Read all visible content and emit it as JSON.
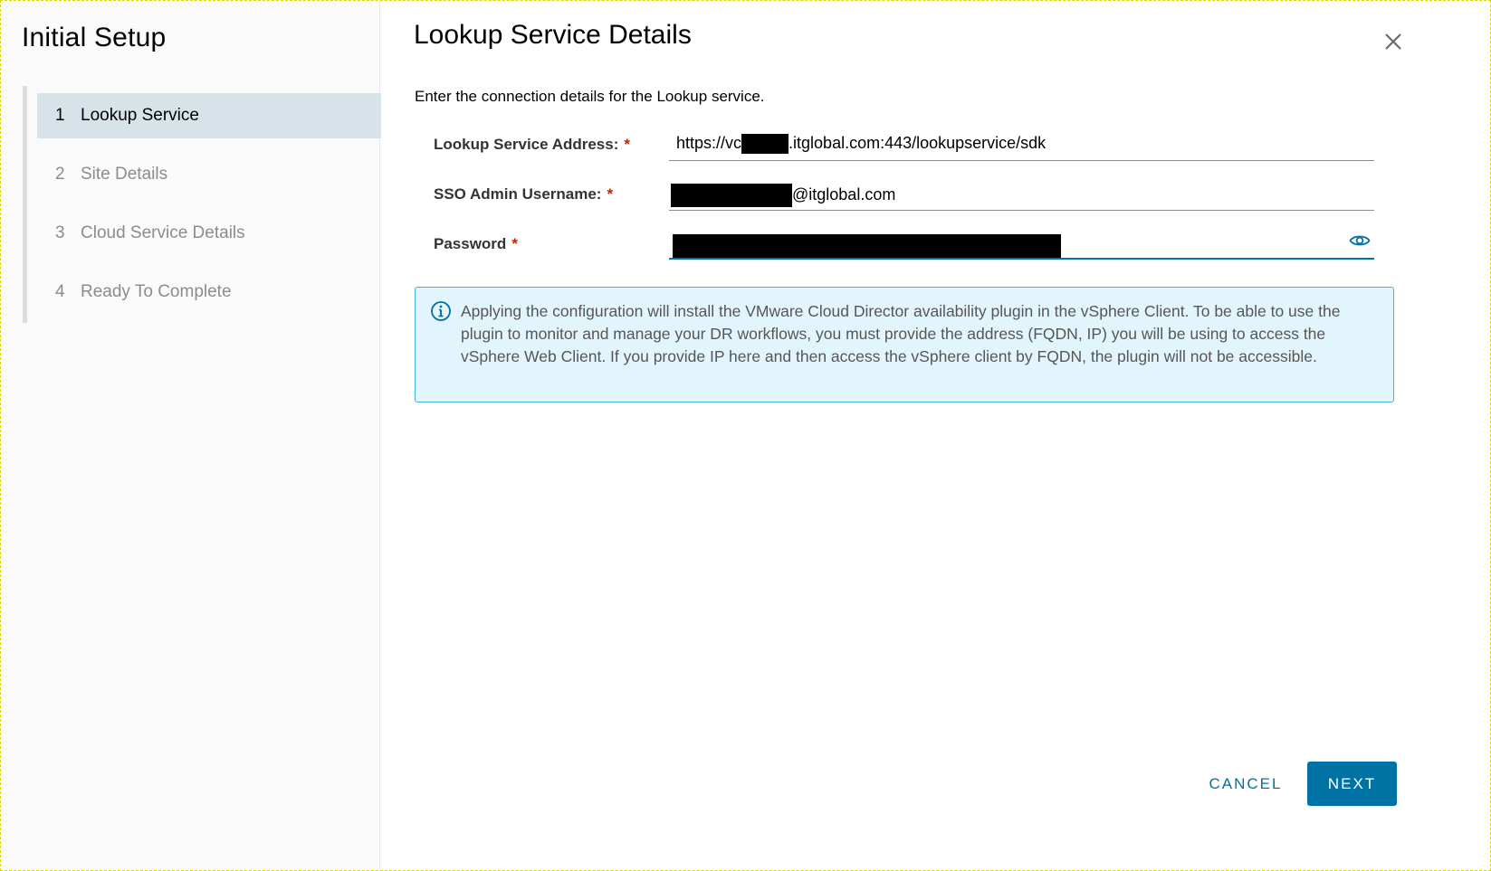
{
  "sidebar": {
    "title": "Initial Setup",
    "steps": [
      {
        "number": "1",
        "label": "Lookup Service",
        "active": true
      },
      {
        "number": "2",
        "label": "Site Details",
        "active": false
      },
      {
        "number": "3",
        "label": "Cloud Service Details",
        "active": false
      },
      {
        "number": "4",
        "label": "Ready To Complete",
        "active": false
      }
    ]
  },
  "main": {
    "title": "Lookup Service Details",
    "intro": "Enter the connection details for the Lookup service.",
    "fields": {
      "address": {
        "label": "Lookup Service Address:",
        "required": "*",
        "value_prefix": "https://vc",
        "value_suffix": ".itglobal.com:443/lookupservice/sdk"
      },
      "username": {
        "label": "SSO Admin Username:",
        "required": "*",
        "value_suffix": "@itglobal.com"
      },
      "password": {
        "label": "Password",
        "required": "*"
      }
    },
    "alert": {
      "icon": "info-circle-icon",
      "text": "Applying the configuration will install the VMware Cloud Director availability plugin in the vSphere Client. To be able to use the plugin to monitor and manage your DR workflows, you must provide the address (FQDN, IP) you will be using to access the vSphere Web Client. If you provide IP here and then access the vSphere client by FQDN, the plugin will not be accessible."
    },
    "buttons": {
      "cancel": "CANCEL",
      "next": "NEXT"
    }
  },
  "colors": {
    "accent": "#0072a3",
    "active_step_bg": "#d8e3e9",
    "alert_bg": "#e3f5fc",
    "alert_border": "#49afd9",
    "required": "#c92100"
  }
}
